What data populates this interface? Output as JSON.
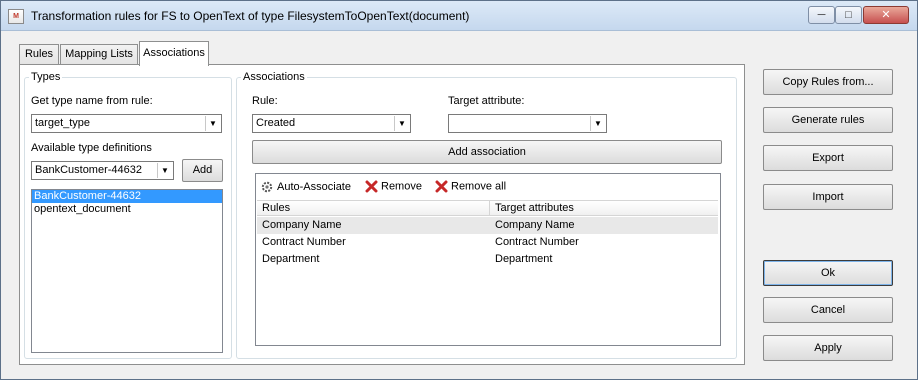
{
  "window": {
    "icon_text": "M",
    "title": "Transformation rules for FS to OpenText of type FilesystemToOpenText(document)",
    "controls": {
      "minimize": "─",
      "maximize": "□",
      "close": "✕"
    }
  },
  "tabs": [
    {
      "label": "Rules"
    },
    {
      "label": "Mapping Lists"
    },
    {
      "label": "Associations"
    }
  ],
  "types": {
    "legend": "Types",
    "get_type_label": "Get type name from rule:",
    "get_type_value": "target_type",
    "available_label": "Available type definitions",
    "available_value": "BankCustomer-44632",
    "add_label": "Add",
    "list": [
      "BankCustomer-44632",
      "opentext_document"
    ],
    "selected_index": 0
  },
  "associations": {
    "legend": "Associations",
    "rule_label": "Rule:",
    "rule_value": "Created",
    "target_label": "Target attribute:",
    "target_value": "",
    "add_association_label": "Add association",
    "toolbar": {
      "auto_associate": "Auto-Associate",
      "remove": "Remove",
      "remove_all": "Remove all"
    },
    "columns": [
      "Rules",
      "Target attributes"
    ],
    "rows": [
      [
        "Company Name",
        "Company Name"
      ],
      [
        "Contract Number",
        "Contract Number"
      ],
      [
        "Department",
        "Department"
      ]
    ]
  },
  "actions": {
    "copy_rules": "Copy Rules from...",
    "generate_rules": "Generate rules",
    "export": "Export",
    "import": "Import",
    "ok": "Ok",
    "cancel": "Cancel",
    "apply": "Apply"
  },
  "colors": {
    "selection": "#3399ff",
    "remove_icon": "#c62828"
  }
}
